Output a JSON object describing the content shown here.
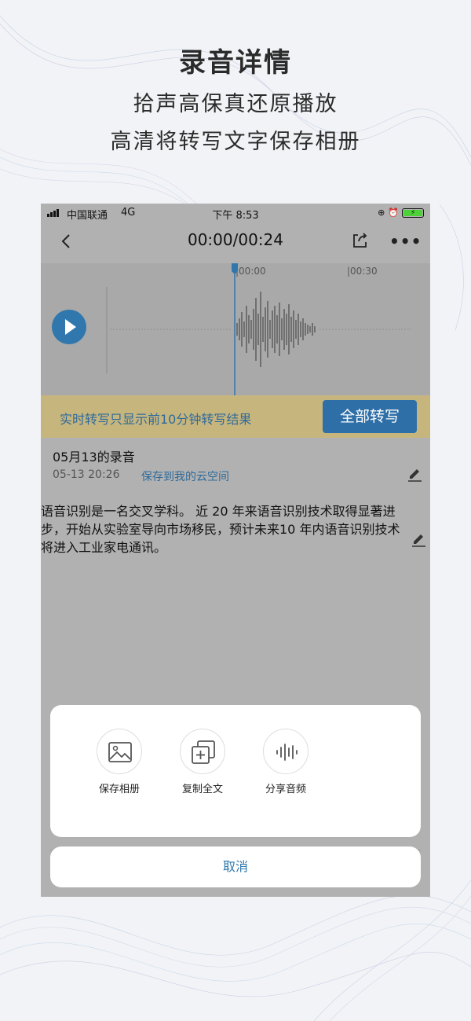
{
  "promo": {
    "title": "录音详情",
    "line1": "拾声高保真还原播放",
    "line2": "高清将转写文字保存相册"
  },
  "status_bar": {
    "carrier": "中国联通",
    "network": "4G",
    "time": "下午 8:53"
  },
  "player": {
    "time": "00:00/00:24",
    "ticks": [
      "|00:00",
      "|00:30"
    ]
  },
  "notice": {
    "text": "实时转写只显示前10分钟转写结果",
    "button": "全部转写"
  },
  "record": {
    "title": "05月13的录音",
    "date": "05-13 20:26",
    "cloud_link": "保存到我的云空间",
    "transcript": "语音识别是一名交叉学科。 近 20 年来语音识别技术取得显著进步，开始从实验室导向市场移民，预计未来10 年内语音识别技术将进入工业家电通讯。"
  },
  "action_sheet": {
    "items": [
      {
        "label": "保存相册",
        "icon": "image-icon"
      },
      {
        "label": "复制全文",
        "icon": "copy-icon"
      },
      {
        "label": "分享音频",
        "icon": "audio-wave-icon"
      }
    ],
    "cancel": "取消"
  },
  "colors": {
    "accent": "#2f77ad",
    "notice_bg": "#c7b57e",
    "overlay": "#b1b1b1"
  }
}
